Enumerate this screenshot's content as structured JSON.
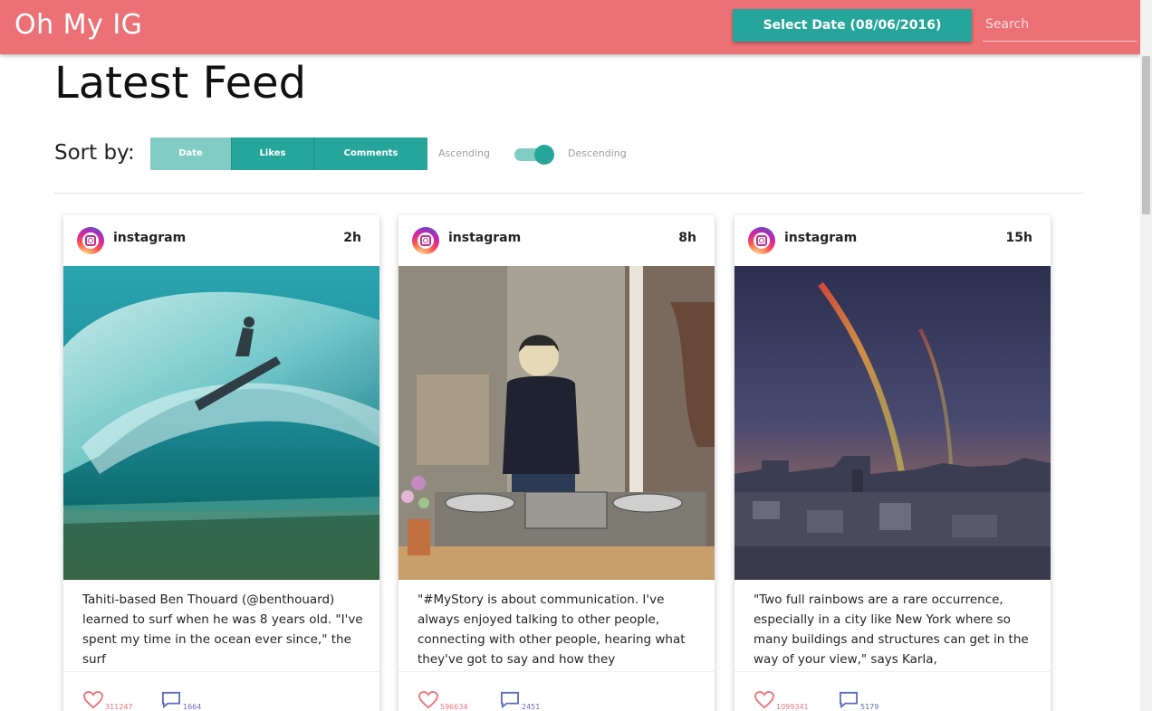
{
  "navbar": {
    "brand": "Oh My IG",
    "date_button": "Select Date (08/06/2016)",
    "search_placeholder": "Search"
  },
  "page": {
    "title": "Latest Feed"
  },
  "sort": {
    "label": "Sort by:",
    "options": [
      "Date",
      "Likes",
      "Comments"
    ],
    "active": "Date",
    "ascending_label": "Ascending",
    "descending_label": "Descending",
    "descending": true
  },
  "posts": [
    {
      "username": "instagram",
      "time": "2h",
      "caption": "Tahiti-based Ben Thouard (@benthouard) learned to surf when he was 8 years old. \"I've spent my time in the ocean ever since,\" the surf",
      "likes": "311247",
      "comments": "1664",
      "photo": "surfer-wave"
    },
    {
      "username": "instagram",
      "time": "8h",
      "caption": "\"#MyStory is about communication. I've always enjoyed talking to other people, connecting with other people, hearing what they've got to say and how they",
      "likes": "596634",
      "comments": "2451",
      "photo": "dj-turntables"
    },
    {
      "username": "instagram",
      "time": "15h",
      "caption": "\"Two full rainbows are a rare occurrence, especially in a city like New York where so many buildings and structures can get in the way of your view,\" says Karla,",
      "likes": "1099341",
      "comments": "5179",
      "photo": "rainbow-city"
    }
  ],
  "colors": {
    "navbar": "#ec7176",
    "accent": "#26a69a",
    "accent_light": "#80cbc4",
    "like": "#ec7176",
    "comment": "#5c6bc0"
  }
}
